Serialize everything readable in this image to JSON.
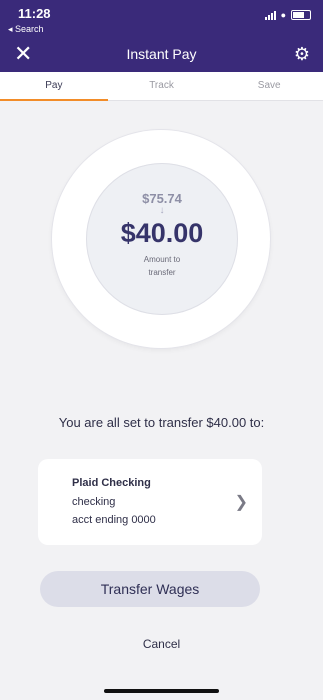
{
  "status_bar": {
    "time": "11:28",
    "back_label": "◂ Search"
  },
  "nav": {
    "title": "Instant Pay",
    "close_icon": "close-icon",
    "settings_icon": "gear-icon"
  },
  "tabs": [
    {
      "label": "Pay",
      "active": true
    },
    {
      "label": "Track",
      "active": false
    },
    {
      "label": "Save",
      "active": false
    }
  ],
  "amounts": {
    "available": "$75.74",
    "transfer": "$40.00",
    "label": "Amount to transfer",
    "arrow_icon": "arrow-down-icon"
  },
  "summary_text": "You are all set to transfer $40.00 to:",
  "account": {
    "name": "Plaid Checking",
    "type": "checking",
    "number_text": "acct ending 0000"
  },
  "actions": {
    "transfer_label": "Transfer Wages",
    "cancel_label": "Cancel"
  },
  "colors": {
    "header": "#3a2a7a",
    "accent": "#f28c28",
    "amount": "#36346a",
    "button": "#dcdde8"
  }
}
